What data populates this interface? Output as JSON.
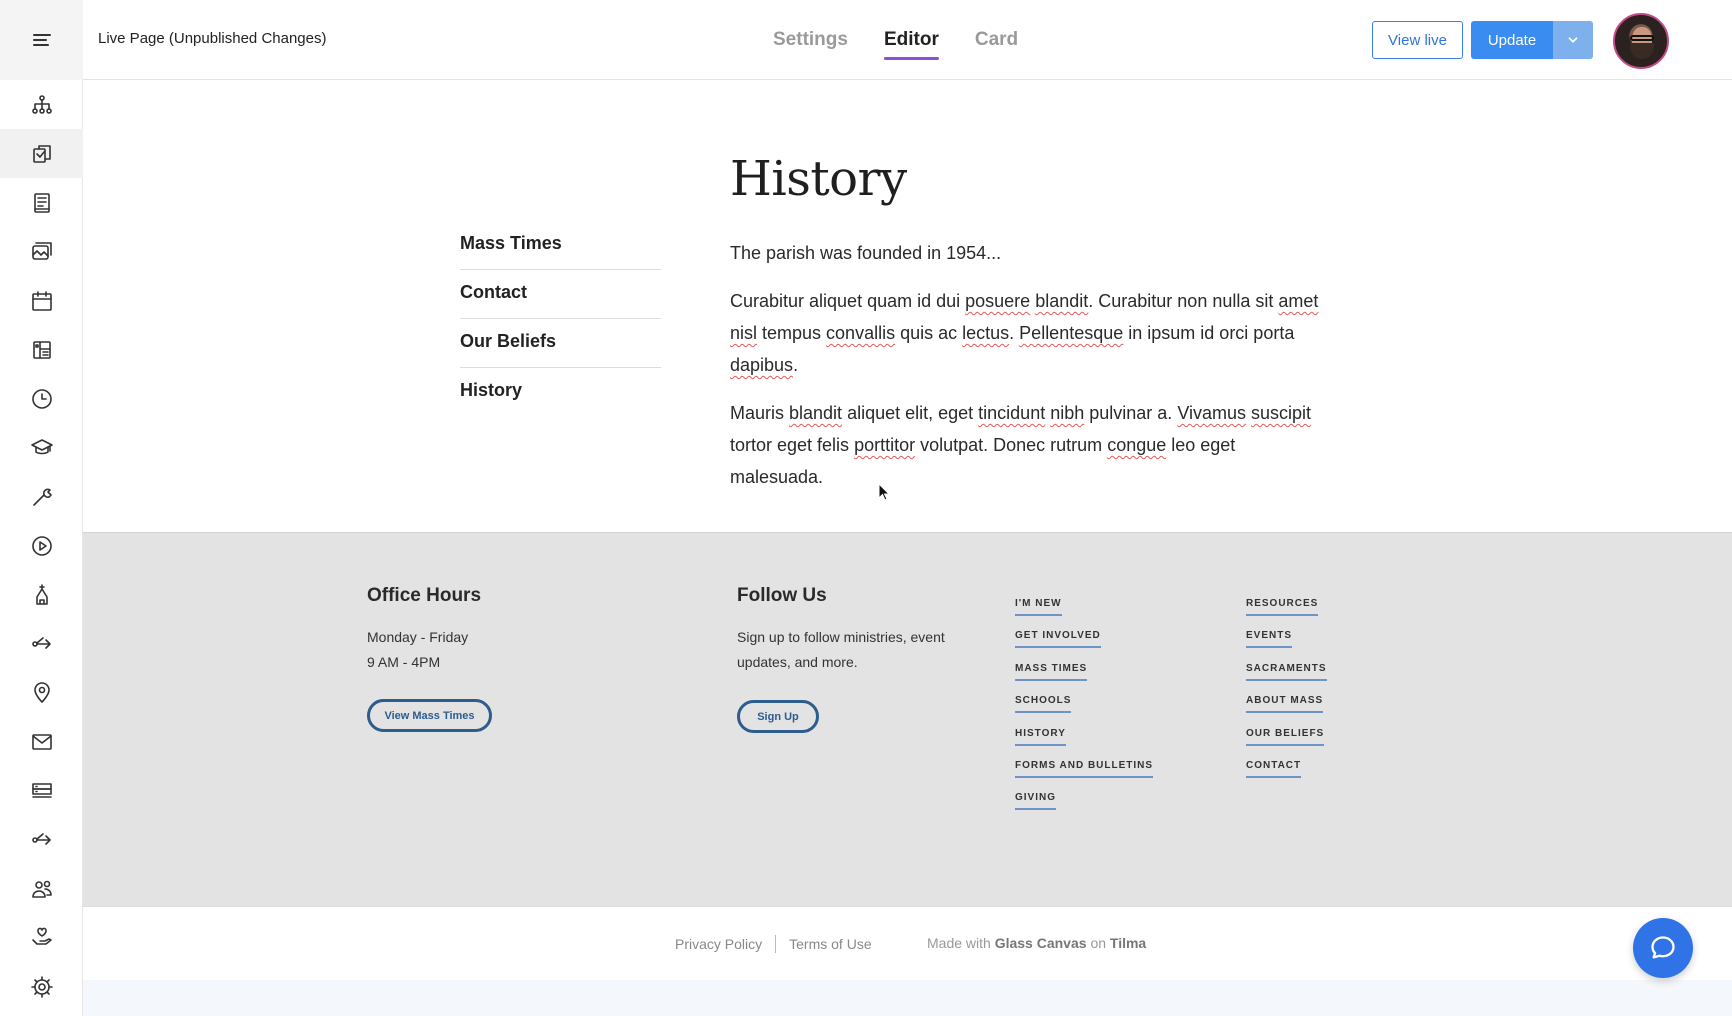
{
  "header": {
    "page_status": "Live Page (Unpublished Changes)",
    "tabs": [
      {
        "label": "Settings",
        "active": false
      },
      {
        "label": "Editor",
        "active": true
      },
      {
        "label": "Card",
        "active": false
      }
    ],
    "view_live_label": "View live",
    "update_label": "Update",
    "accent_color": "#8a4fd6",
    "primary_color": "#3b8cf0"
  },
  "sidebar": {
    "items": [
      "sitemap-icon",
      "pages-icon",
      "book-icon",
      "media-icon",
      "calendar-icon",
      "layout-icon",
      "clock-icon",
      "graduation-cap-icon",
      "wrench-icon",
      "play-icon",
      "church-icon",
      "share-icon",
      "location-pin-icon",
      "mail-icon",
      "server-icon",
      "share-icon",
      "users-icon",
      "donate-hand-icon",
      "gear-icon"
    ],
    "active_index": 1
  },
  "sub_nav": [
    "Mass Times",
    "Contact",
    "Our Beliefs",
    "History"
  ],
  "article": {
    "title": "History",
    "intro": "The parish was founded in 1954...",
    "p1": {
      "s1": "Curabitur aliquet quam id dui ",
      "w1": "posuere",
      "s2": " ",
      "w2": "blandit",
      "s3": ". Curabitur non nulla sit ",
      "w3": "amet",
      "s4": " ",
      "w4": "nisl",
      "s5": " tempus ",
      "w5": "convallis",
      "s6": " quis ac ",
      "w6": "lectus",
      "s7": ". ",
      "w7": "Pellentesque",
      "s8": " in ipsum id orci porta ",
      "w8": "dapibus",
      "s9": "."
    },
    "p2": {
      "s1": "Mauris ",
      "w1": "blandit",
      "s2": " aliquet elit, eget ",
      "w2": "tincidunt",
      "s3": " ",
      "w3": "nibh",
      "s4": " pulvinar a. ",
      "w4": "Vivamus",
      "s5": " ",
      "w5": "suscipit",
      "s6": " tortor eget felis ",
      "w6": "porttitor",
      "s7": " volutpat. Donec rutrum ",
      "w7": "congue",
      "s8": " leo eget malesuada."
    }
  },
  "footer": {
    "office": {
      "title": "Office Hours",
      "line1": "Monday - Friday",
      "line2": "9 AM - 4PM",
      "button": "View Mass Times"
    },
    "follow": {
      "title": "Follow Us",
      "line1": "Sign up to follow ministries, event",
      "line2": "updates, and more.",
      "button": "Sign Up"
    },
    "links_col1": [
      "I'M NEW",
      "GET INVOLVED",
      "MASS TIMES",
      "SCHOOLS",
      "HISTORY",
      "FORMS AND BULLETINS",
      "GIVING"
    ],
    "links_col2": [
      "RESOURCES",
      "EVENTS",
      "SACRAMENTS",
      "ABOUT MASS",
      "OUR BELIEFS",
      "CONTACT"
    ],
    "link_underline_color": "#6b95c8"
  },
  "bottom": {
    "privacy": "Privacy Policy",
    "terms": "Terms of Use",
    "made_with": "Made with",
    "glass_canvas": "Glass Canvas",
    "on": "on",
    "tilma": "Tilma"
  }
}
